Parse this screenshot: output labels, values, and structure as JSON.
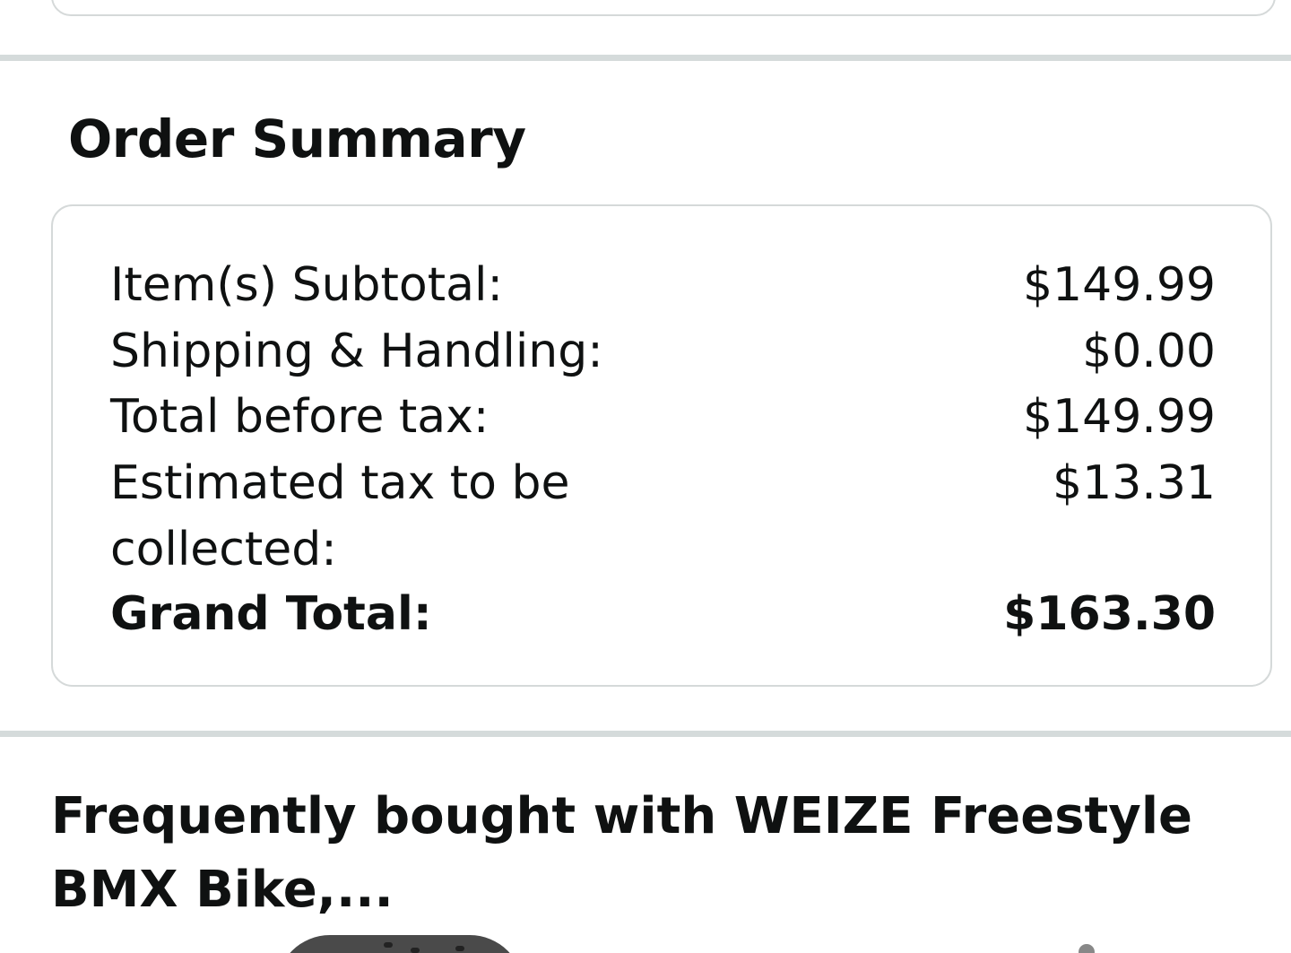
{
  "order_summary": {
    "title": "Order Summary",
    "rows": [
      {
        "label": "Item(s) Subtotal:",
        "value": "$149.99"
      },
      {
        "label": "Shipping & Handling:",
        "value": "$0.00"
      },
      {
        "label": "Total before tax:",
        "value": "$149.99"
      },
      {
        "label": "Estimated tax to be collected:",
        "value": "$13.31"
      },
      {
        "label": "Grand Total:",
        "value": "$163.30"
      }
    ]
  },
  "frequently_bought": {
    "title": "Frequently bought with WEIZE Freestyle BMX Bike,..."
  },
  "colors": {
    "text": "#0f1111",
    "border": "#d5d9d9",
    "divider": "#d5dbdb"
  },
  "icons": {
    "product_thumbnail_1": "helmet-product-image",
    "product_thumbnail_2": "product-image"
  }
}
